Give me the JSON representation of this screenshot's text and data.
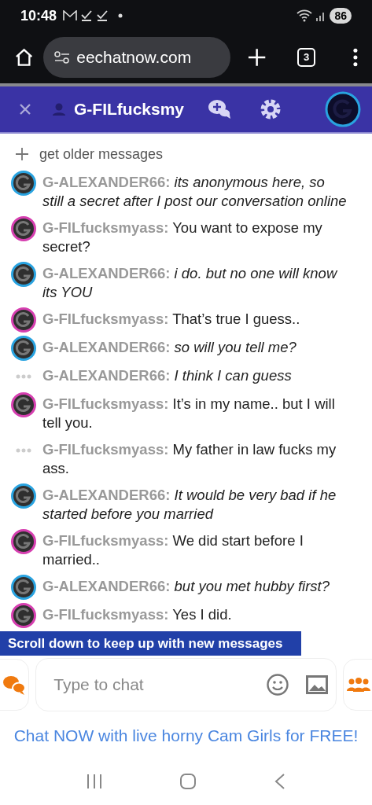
{
  "status_bar": {
    "time": "10:48",
    "battery": "86"
  },
  "browser": {
    "url": "eechatnow.com",
    "tab_count": "3"
  },
  "header": {
    "title": "G-FILfucksmy"
  },
  "older_link": "get older messages",
  "messages": [
    {
      "kind": "avatar",
      "color": "#29a3e0",
      "sender": "G-ALEXANDER66:",
      "text": "its anonymous here, so still a secret after I post our conversation online",
      "italic": true
    },
    {
      "kind": "avatar",
      "color": "#d63fb0",
      "sender": "G-FILfucksmyass:",
      "text": "You want to expose my secret?",
      "italic": false
    },
    {
      "kind": "avatar",
      "color": "#29a3e0",
      "sender": "G-ALEXANDER66:",
      "text": "i do. but no one will know its YOU",
      "italic": true
    },
    {
      "kind": "avatar",
      "color": "#d63fb0",
      "sender": "G-FILfucksmyass:",
      "text": "That’s true I guess..",
      "italic": false
    },
    {
      "kind": "avatar",
      "color": "#29a3e0",
      "sender": "G-ALEXANDER66:",
      "text": "so will you tell me?",
      "italic": true
    },
    {
      "kind": "dots",
      "sender": "G-ALEXANDER66:",
      "text": "I think I can guess",
      "italic": true
    },
    {
      "kind": "avatar",
      "color": "#d63fb0",
      "sender": "G-FILfucksmyass:",
      "text": "It’s in my name.. but I will tell you.",
      "italic": false
    },
    {
      "kind": "dots",
      "sender": "G-FILfucksmyass:",
      "text": "My father in law fucks my ass.",
      "italic": false
    },
    {
      "kind": "avatar",
      "color": "#29a3e0",
      "sender": "G-ALEXANDER66:",
      "text": "It would be very bad if he started before you married",
      "italic": true
    },
    {
      "kind": "avatar",
      "color": "#d63fb0",
      "sender": "G-FILfucksmyass:",
      "text": "We did start before I married..",
      "italic": false
    },
    {
      "kind": "avatar",
      "color": "#29a3e0",
      "sender": "G-ALEXANDER66:",
      "text": "but you met hubby first?",
      "italic": true
    },
    {
      "kind": "avatar",
      "color": "#d63fb0",
      "sender": "G-FILfucksmyass:",
      "text": "Yes I did.",
      "italic": false
    }
  ],
  "scroll_banner": "Scroll down to keep up with new messages",
  "composer": {
    "placeholder": "Type to chat"
  },
  "ad_link": "Chat NOW with live horny Cam Girls for FREE!"
}
